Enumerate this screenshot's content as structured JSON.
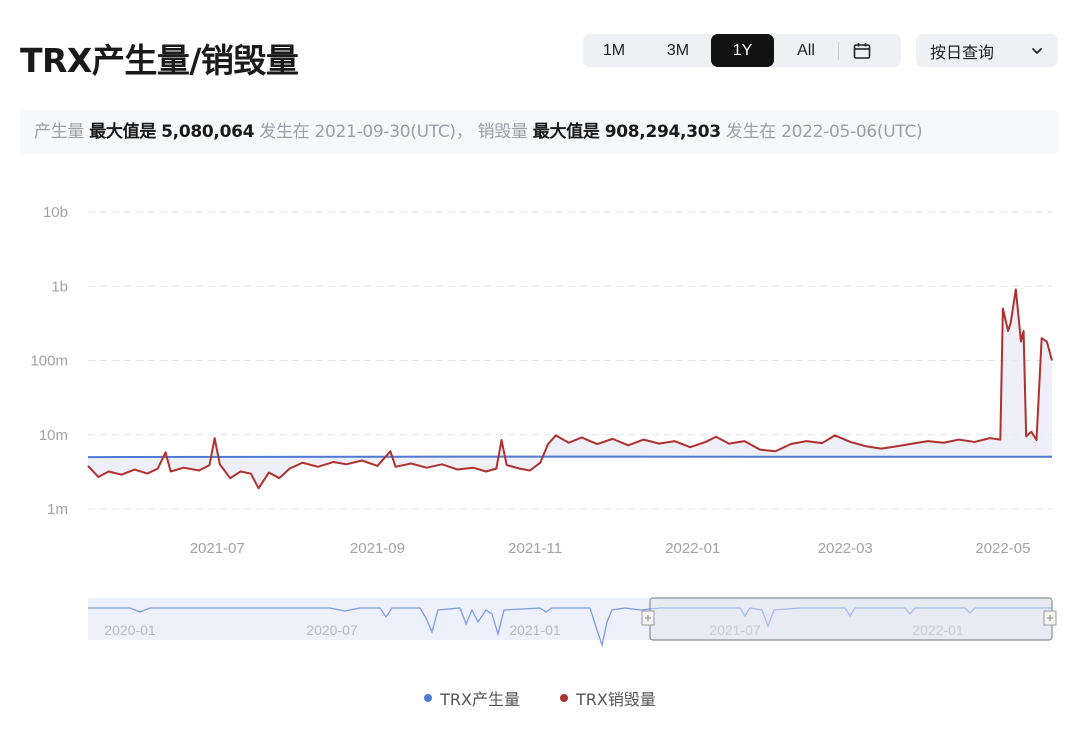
{
  "title": "TRX产生量/销毁量",
  "ranges": [
    {
      "label": "1M",
      "active": false
    },
    {
      "label": "3M",
      "active": false
    },
    {
      "label": "1Y",
      "active": true
    },
    {
      "label": "All",
      "active": false
    }
  ],
  "query_select": "按日查询",
  "summary": {
    "production_label": "产生量",
    "production_max_label": "最大值是",
    "production_max_value": "5,080,064",
    "production_on": "发生在",
    "production_date": "2021-09-30(UTC)",
    "separator": "，",
    "burn_label": "销毁量",
    "burn_max_label": "最大值是",
    "burn_max_value": "908,294,303",
    "burn_on": "发生在",
    "burn_date": "2022-05-06(UTC)"
  },
  "colors": {
    "production": "#4e7ad6",
    "burn": "#b0302e",
    "grid": "#e3e3e3",
    "axis_text": "#a3a3a3"
  },
  "chart_data": {
    "type": "line",
    "y_scale": "log",
    "ylim": [
      1000000,
      10000000000
    ],
    "y_ticks": [
      {
        "value": 1000000,
        "label": "1m"
      },
      {
        "value": 10000000,
        "label": "10m"
      },
      {
        "value": 100000000,
        "label": "100m"
      },
      {
        "value": 1000000000,
        "label": "1b"
      },
      {
        "value": 10000000000,
        "label": "10b"
      }
    ],
    "x_range": [
      "2021-05-12",
      "2022-05-20"
    ],
    "x_ticks": [
      {
        "date": "2021-07-01",
        "label": "2021-07"
      },
      {
        "date": "2021-09-01",
        "label": "2021-09"
      },
      {
        "date": "2021-11-01",
        "label": "2021-11"
      },
      {
        "date": "2022-01-01",
        "label": "2022-01"
      },
      {
        "date": "2022-03-01",
        "label": "2022-03"
      },
      {
        "date": "2022-05-01",
        "label": "2022-05"
      }
    ],
    "grid": true,
    "legend_position": "bottom-center",
    "series": [
      {
        "name": "TRX产生量",
        "color": "#4e7ad6",
        "points": [
          [
            "2021-05-12",
            5000000
          ],
          [
            "2021-09-30",
            5080064
          ],
          [
            "2022-05-20",
            5050000
          ]
        ]
      },
      {
        "name": "TRX销毁量",
        "color": "#b0302e",
        "points": [
          [
            "2021-05-12",
            3800000
          ],
          [
            "2021-05-16",
            2700000
          ],
          [
            "2021-05-20",
            3200000
          ],
          [
            "2021-05-25",
            2900000
          ],
          [
            "2021-05-30",
            3400000
          ],
          [
            "2021-06-04",
            3000000
          ],
          [
            "2021-06-08",
            3500000
          ],
          [
            "2021-06-11",
            5800000
          ],
          [
            "2021-06-13",
            3200000
          ],
          [
            "2021-06-18",
            3600000
          ],
          [
            "2021-06-24",
            3300000
          ],
          [
            "2021-06-28",
            3900000
          ],
          [
            "2021-06-30",
            9000000
          ],
          [
            "2021-07-02",
            4000000
          ],
          [
            "2021-07-06",
            2600000
          ],
          [
            "2021-07-10",
            3200000
          ],
          [
            "2021-07-14",
            3000000
          ],
          [
            "2021-07-17",
            1900000
          ],
          [
            "2021-07-21",
            3100000
          ],
          [
            "2021-07-25",
            2600000
          ],
          [
            "2021-07-29",
            3500000
          ],
          [
            "2021-08-03",
            4200000
          ],
          [
            "2021-08-09",
            3700000
          ],
          [
            "2021-08-15",
            4300000
          ],
          [
            "2021-08-20",
            4000000
          ],
          [
            "2021-08-26",
            4500000
          ],
          [
            "2021-09-01",
            3800000
          ],
          [
            "2021-09-06",
            6000000
          ],
          [
            "2021-09-08",
            3700000
          ],
          [
            "2021-09-14",
            4100000
          ],
          [
            "2021-09-20",
            3600000
          ],
          [
            "2021-09-26",
            4000000
          ],
          [
            "2021-10-02",
            3400000
          ],
          [
            "2021-10-08",
            3600000
          ],
          [
            "2021-10-13",
            3200000
          ],
          [
            "2021-10-17",
            3500000
          ],
          [
            "2021-10-19",
            8500000
          ],
          [
            "2021-10-21",
            3900000
          ],
          [
            "2021-10-26",
            3500000
          ],
          [
            "2021-10-30",
            3300000
          ],
          [
            "2021-11-03",
            4200000
          ],
          [
            "2021-11-06",
            7500000
          ],
          [
            "2021-11-09",
            9800000
          ],
          [
            "2021-11-14",
            7800000
          ],
          [
            "2021-11-19",
            9200000
          ],
          [
            "2021-11-25",
            7500000
          ],
          [
            "2021-12-01",
            8800000
          ],
          [
            "2021-12-07",
            7200000
          ],
          [
            "2021-12-13",
            8600000
          ],
          [
            "2021-12-19",
            7600000
          ],
          [
            "2021-12-25",
            8200000
          ],
          [
            "2021-12-31",
            6800000
          ],
          [
            "2022-01-06",
            8000000
          ],
          [
            "2022-01-10",
            9400000
          ],
          [
            "2022-01-15",
            7600000
          ],
          [
            "2022-01-21",
            8200000
          ],
          [
            "2022-01-27",
            6300000
          ],
          [
            "2022-02-02",
            6000000
          ],
          [
            "2022-02-08",
            7500000
          ],
          [
            "2022-02-14",
            8200000
          ],
          [
            "2022-02-20",
            7700000
          ],
          [
            "2022-02-25",
            9800000
          ],
          [
            "2022-03-03",
            8000000
          ],
          [
            "2022-03-09",
            7000000
          ],
          [
            "2022-03-15",
            6500000
          ],
          [
            "2022-03-21",
            7000000
          ],
          [
            "2022-03-27",
            7600000
          ],
          [
            "2022-04-02",
            8200000
          ],
          [
            "2022-04-08",
            7800000
          ],
          [
            "2022-04-14",
            8600000
          ],
          [
            "2022-04-20",
            8000000
          ],
          [
            "2022-04-26",
            9000000
          ],
          [
            "2022-04-30",
            8600000
          ],
          [
            "2022-05-01",
            500000000
          ],
          [
            "2022-05-03",
            250000000
          ],
          [
            "2022-05-04",
            320000000
          ],
          [
            "2022-05-06",
            908294303
          ],
          [
            "2022-05-08",
            180000000
          ],
          [
            "2022-05-09",
            250000000
          ],
          [
            "2022-05-10",
            9500000
          ],
          [
            "2022-05-12",
            11000000
          ],
          [
            "2022-05-14",
            8500000
          ],
          [
            "2022-05-16",
            200000000
          ],
          [
            "2022-05-18",
            180000000
          ],
          [
            "2022-05-20",
            100000000
          ]
        ]
      }
    ]
  },
  "navigator": {
    "tick_labels": [
      "2020-01",
      "2020-07",
      "2021-01",
      "2021-07",
      "2022-01"
    ]
  },
  "legend": [
    {
      "label": "TRX产生量",
      "color": "#4e7ad6"
    },
    {
      "label": "TRX销毁量",
      "color": "#b0302e"
    }
  ]
}
